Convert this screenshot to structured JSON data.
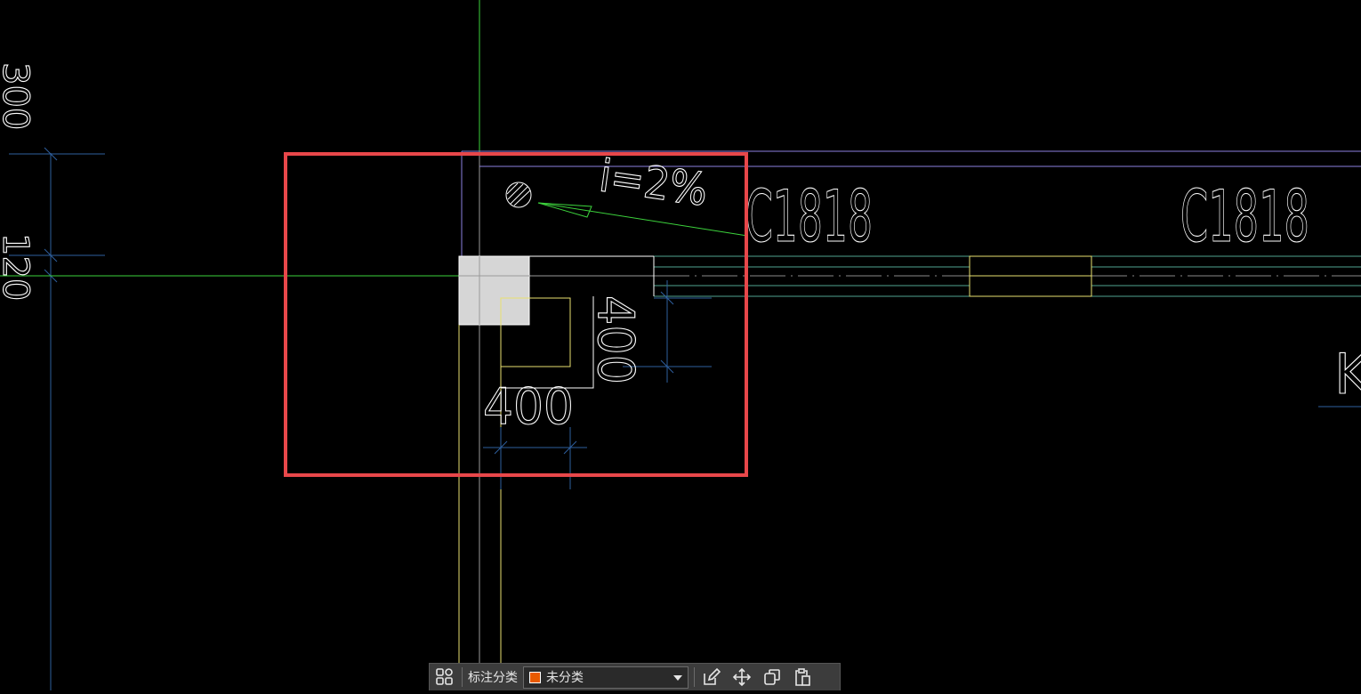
{
  "drawing": {
    "labels": {
      "slope": "i=2%",
      "window_tag_1": "C1818",
      "window_tag_2": "C1818",
      "dim_horizontal": "400",
      "dim_vertical": "400",
      "dim_left_top": "300",
      "dim_left_mid": "120",
      "partial_right": "K"
    },
    "colors": {
      "background": "#000000",
      "highlight_box": "#e8474a",
      "axis_green": "#3cd23c",
      "dim_blue": "#2e5f9e",
      "wall_purple": "#8c80e0",
      "column_yellow": "#e8e070",
      "wall_teal": "#4fa38f",
      "column_fill": "#d6d6d6",
      "text": "#ffffff"
    }
  },
  "toolbar": {
    "grid_icon": "grid-icon",
    "category_label": "标注分类",
    "category_value": "未分类",
    "category_color": "#e85a00",
    "edit_icon": "edit-icon",
    "move_icon": "move-icon",
    "copy_icon": "copy-icon",
    "paste_icon": "paste-icon"
  }
}
